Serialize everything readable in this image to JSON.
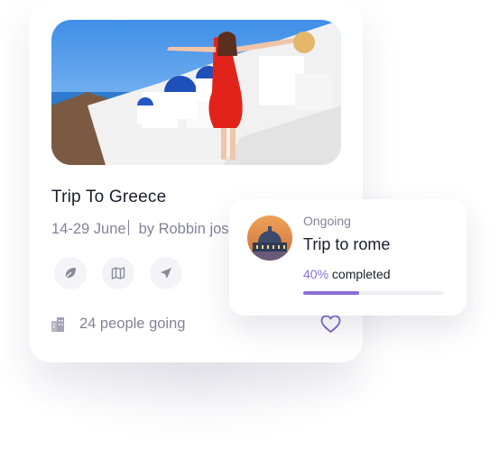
{
  "trip_card": {
    "title": "Trip To Greece",
    "dates": "14-29 June",
    "organizer": "by Robbin joseph",
    "actions": [
      {
        "icon": "leaf-icon"
      },
      {
        "icon": "map-icon"
      },
      {
        "icon": "send-icon"
      }
    ],
    "people_icon": "building-icon",
    "people_label": "24 people going",
    "favorite_icon": "heart-icon"
  },
  "progress_card": {
    "status": "Ongoing",
    "title": "Trip to rome",
    "percent_label": "40%",
    "completed_label": " completed",
    "progress": 0.4
  },
  "colors": {
    "accent": "#8a6fd6",
    "text_dark": "#1c1c2b",
    "text_muted": "#84829a"
  }
}
